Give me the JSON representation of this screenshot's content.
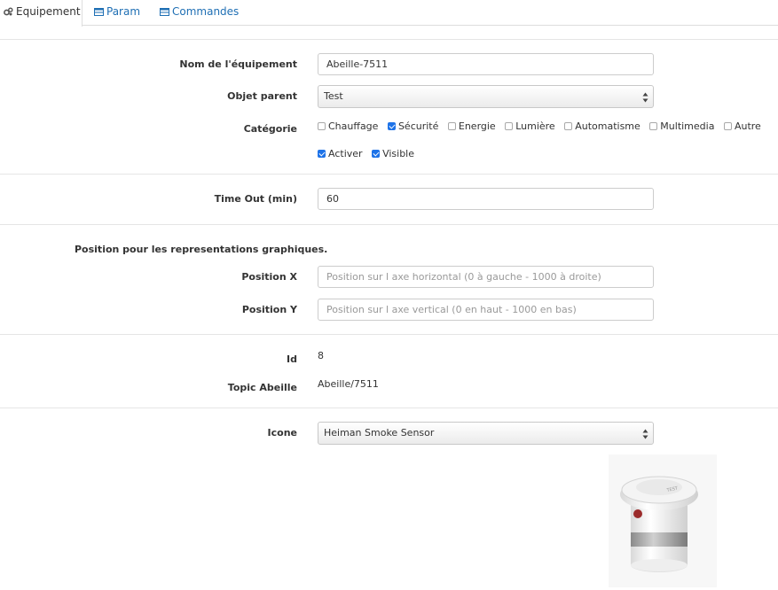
{
  "tabs": {
    "equipement": "Equipement",
    "param": "Param",
    "commandes": "Commandes"
  },
  "form": {
    "nom": {
      "label": "Nom de l'équipement",
      "value": "Abeille-7511"
    },
    "objet_parent": {
      "label": "Objet parent",
      "value": "Test"
    },
    "categorie": {
      "label": "Catégorie",
      "items": [
        {
          "label": "Chauffage",
          "checked": false
        },
        {
          "label": "Sécurité",
          "checked": true
        },
        {
          "label": "Energie",
          "checked": false
        },
        {
          "label": "Lumière",
          "checked": false
        },
        {
          "label": "Automatisme",
          "checked": false
        },
        {
          "label": "Multimedia",
          "checked": false
        },
        {
          "label": "Autre",
          "checked": false
        }
      ]
    },
    "options": [
      {
        "label": "Activer",
        "checked": true
      },
      {
        "label": "Visible",
        "checked": true
      }
    ],
    "timeout": {
      "label": "Time Out (min)",
      "value": "60"
    },
    "position_section_title": "Position pour les representations graphiques.",
    "position_x": {
      "label": "Position X",
      "placeholder": "Position sur l axe horizontal (0 à gauche - 1000 à droite)"
    },
    "position_y": {
      "label": "Position Y",
      "placeholder": "Position sur l axe vertical (0 en haut - 1000 en bas)"
    },
    "id": {
      "label": "Id",
      "value": "8"
    },
    "topic": {
      "label": "Topic Abeille",
      "value": "Abeille/7511"
    },
    "icone": {
      "label": "Icone",
      "value": "Heiman Smoke Sensor"
    }
  },
  "colors": {
    "link": "#1f6fb4",
    "checkbox_checked": "#1e73e8",
    "border": "#cccccc"
  },
  "icons": {
    "equipement_tab": "cogs-icon",
    "param_tab": "table-icon",
    "commandes_tab": "list-icon",
    "select_arrows": "select-arrows-icon",
    "device_image": "smoke-detector-image"
  }
}
